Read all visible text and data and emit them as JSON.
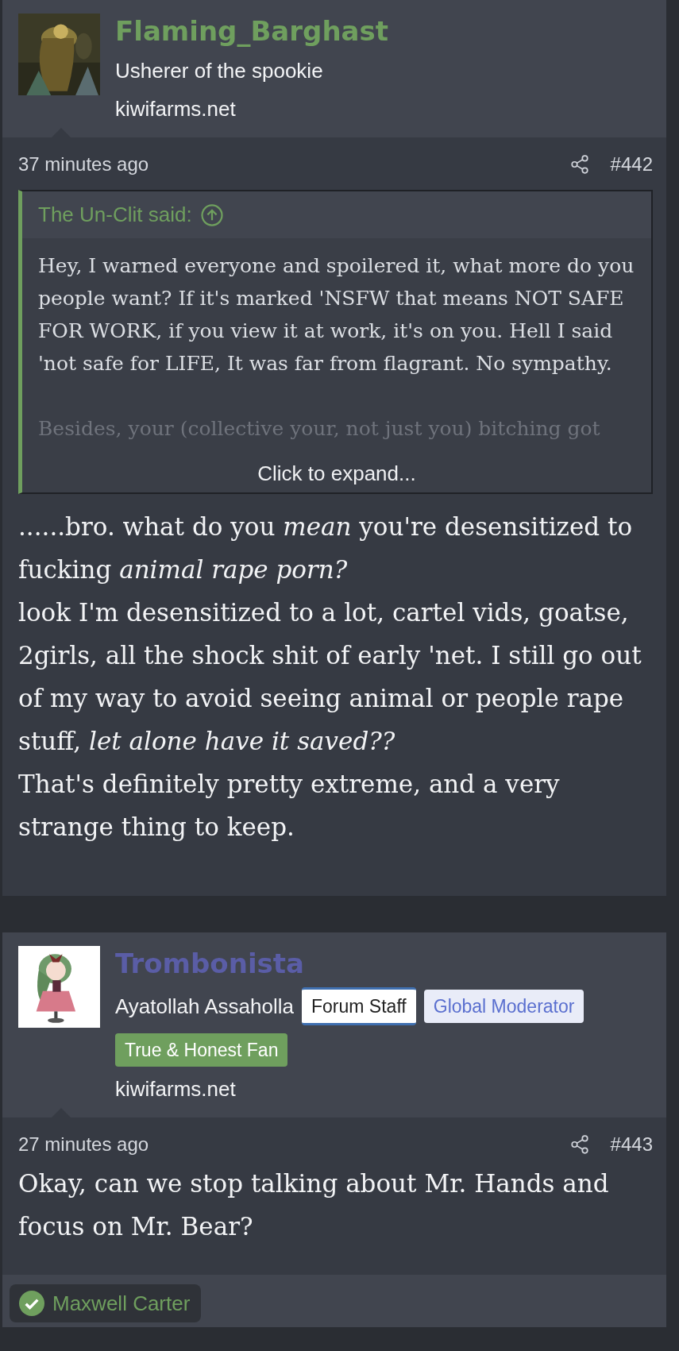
{
  "posts": [
    {
      "author": {
        "name": "Flaming_Barghast",
        "color": "#6f9f5e",
        "title": "Usherer of the spookie",
        "site": "kiwifarms.net"
      },
      "time": "37 minutes ago",
      "number": "#442",
      "quote": {
        "author": "The Un-Clit said:",
        "paragraphs": [
          "Hey, I warned everyone and spoilered it, what more do you people want? If it's marked 'NSFW that means NOT SAFE FOR WORK, if you view it at work, it's on you. Hell I said 'not safe for LIFE, It was far from flagrant. No sympathy.",
          "Besides, your (collective your, not just you) bitching got"
        ],
        "expand": "Click to expand..."
      },
      "body": [
        "......bro. what do you *mean* you're desensitized to fucking *animal rape porn?*",
        "look I'm desensitized to a lot, cartel vids, goatse, 2girls, all the shock shit of early 'net. I still go out of my way to avoid seeing animal or people rape stuff, *let alone have it saved??*",
        "That's definitely pretty extreme, and a very strange thing to keep."
      ]
    },
    {
      "author": {
        "name": "Trombonista",
        "color": "#5a5da6",
        "title": "Ayatollah Assaholla",
        "badges": [
          {
            "kind": "staff",
            "label": "Forum Staff"
          },
          {
            "kind": "moderator",
            "label": "Global Moderator"
          },
          {
            "kind": "fan",
            "label": "True & Honest Fan"
          }
        ],
        "site": "kiwifarms.net"
      },
      "time": "27 minutes ago",
      "number": "#443",
      "body": [
        "Okay, can we stop talking about Mr. Hands and focus on Mr. Bear?"
      ],
      "reactions": [
        {
          "name": "Maxwell Carter"
        }
      ]
    }
  ]
}
